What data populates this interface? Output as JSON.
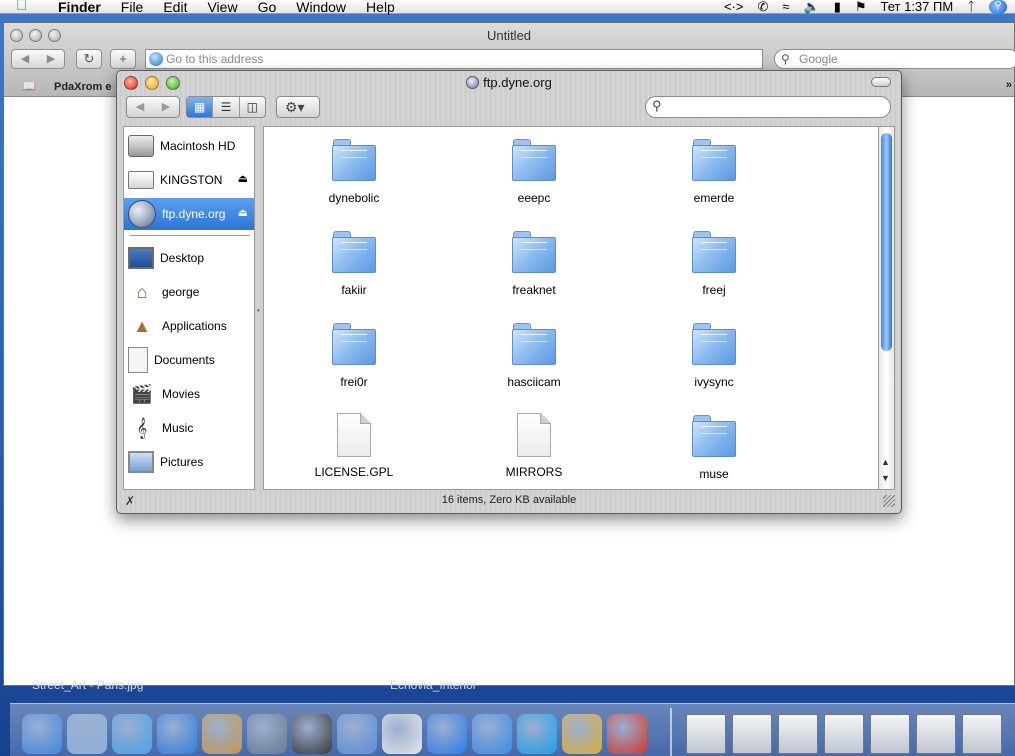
{
  "menubar": {
    "app_name": "Finder",
    "menus": [
      "File",
      "Edit",
      "View",
      "Go",
      "Window",
      "Help"
    ],
    "clock": "Тет 1:37 ПМ"
  },
  "browser": {
    "title": "Untitled",
    "address_placeholder": "Go to this address",
    "search_placeholder": "Google",
    "bookmark": "PdaXrom e"
  },
  "finder": {
    "title": "ftp.dyne.org",
    "search_value": "",
    "status": "16 items, Zero KB available",
    "sidebar_devices": [
      {
        "label": "Macintosh HD",
        "icon": "hard-disk-icon",
        "eject": false,
        "selected": false
      },
      {
        "label": "KINGSTON",
        "icon": "usb-drive-icon",
        "eject": true,
        "selected": false
      },
      {
        "label": "ftp.dyne.org",
        "icon": "network-globe-icon",
        "eject": true,
        "selected": true
      }
    ],
    "sidebar_places": [
      {
        "label": "Desktop",
        "icon": "desktop-icon"
      },
      {
        "label": "george",
        "icon": "home-icon"
      },
      {
        "label": "Applications",
        "icon": "applications-icon"
      },
      {
        "label": "Documents",
        "icon": "documents-icon"
      },
      {
        "label": "Movies",
        "icon": "movies-icon"
      },
      {
        "label": "Music",
        "icon": "music-icon"
      },
      {
        "label": "Pictures",
        "icon": "pictures-icon"
      }
    ],
    "items": [
      {
        "name": "dynebolic",
        "kind": "folder"
      },
      {
        "name": "eeepc",
        "kind": "folder"
      },
      {
        "name": "emerde",
        "kind": "folder"
      },
      {
        "name": "fakiir",
        "kind": "folder"
      },
      {
        "name": "freaknet",
        "kind": "folder"
      },
      {
        "name": "freej",
        "kind": "folder"
      },
      {
        "name": "frei0r",
        "kind": "folder"
      },
      {
        "name": "hasciicam",
        "kind": "folder"
      },
      {
        "name": "ivysync",
        "kind": "folder"
      },
      {
        "name": "LICENSE.GPL",
        "kind": "file"
      },
      {
        "name": "MIRRORS",
        "kind": "file"
      },
      {
        "name": "muse",
        "kind": "folder"
      }
    ]
  },
  "desktop_labels": [
    "Street_Art - Paris.jpg",
    "Echovia_Interior"
  ],
  "dock": {
    "apps": [
      {
        "icon": "finder-icon",
        "color": "#3f8ae0"
      },
      {
        "icon": "mail-icon",
        "color": "#8fb3d9"
      },
      {
        "icon": "safari-icon",
        "color": "#4aa3e8"
      },
      {
        "icon": "ichat-icon",
        "color": "#2f7fe0"
      },
      {
        "icon": "address-book-icon",
        "color": "#c89a4a"
      },
      {
        "icon": "iphoto-icon",
        "color": "#6b7c8e"
      },
      {
        "icon": "imovie-icon",
        "color": "#3a3a3a"
      },
      {
        "icon": "dvd-player-icon",
        "color": "#5c8fd8"
      },
      {
        "icon": "ical-icon",
        "color": "#e8e8e8"
      },
      {
        "icon": "quicktime-icon",
        "color": "#2b7de9"
      },
      {
        "icon": "iz-icon",
        "color": "#3a8ee6"
      },
      {
        "icon": "skype-icon",
        "color": "#1da1e8"
      },
      {
        "icon": "arch-icon",
        "color": "#e0b030"
      },
      {
        "icon": "pomegranate-icon",
        "color": "#d23a2a"
      }
    ],
    "minimized": [
      {
        "icon": "window-thumb-icon"
      },
      {
        "icon": "window-thumb-icon"
      },
      {
        "icon": "window-thumb-icon"
      },
      {
        "icon": "window-thumb-icon"
      },
      {
        "icon": "window-thumb-icon"
      },
      {
        "icon": "window-thumb-icon"
      },
      {
        "icon": "window-thumb-icon"
      }
    ]
  }
}
